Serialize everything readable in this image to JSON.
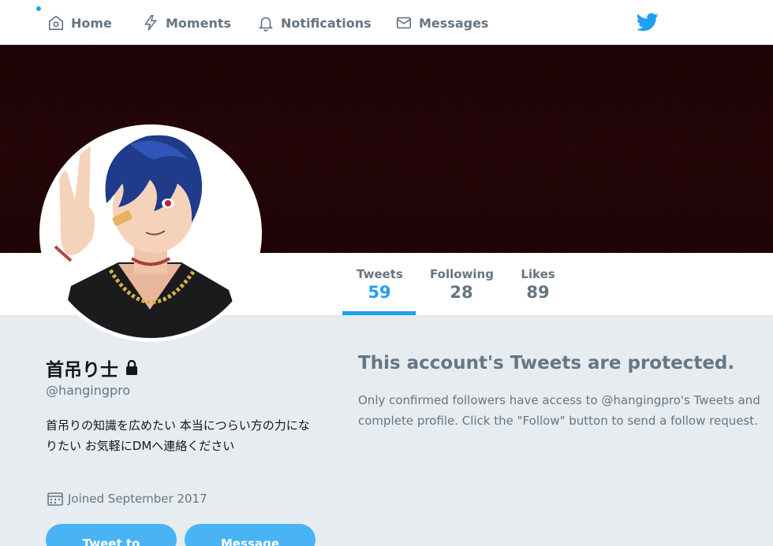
{
  "nav": {
    "items": [
      {
        "label": "Home",
        "icon": "home-icon"
      },
      {
        "label": "Moments",
        "icon": "lightning-icon"
      },
      {
        "label": "Notifications",
        "icon": "bell-icon"
      },
      {
        "label": "Messages",
        "icon": "envelope-icon"
      }
    ],
    "logo": "twitter-bird-icon"
  },
  "profile": {
    "name": "首吊り士",
    "handle": "@hangingpro",
    "bio": "首吊りの知識を広めたい 本当につらい方の力になりたい お気軽にDMへ連絡ください",
    "joined": "Joined September 2017",
    "protected_icon": "lock-icon"
  },
  "stats": [
    {
      "label": "Tweets",
      "value": "59"
    },
    {
      "label": "Following",
      "value": "28"
    },
    {
      "label": "Likes",
      "value": "89"
    }
  ],
  "actions": {
    "tweet_to": "Tweet to",
    "message": "Message"
  },
  "protected": {
    "title": "This account's Tweets are protected.",
    "text": "Only confirmed followers have access to @hangingpro's Tweets and complete profile. Click the \"Follow\" button to send a follow request."
  },
  "colors": {
    "accent": "#1da1f2",
    "button": "#4ab3f4",
    "background": "#e6ecf0",
    "banner": "#1c0507"
  }
}
